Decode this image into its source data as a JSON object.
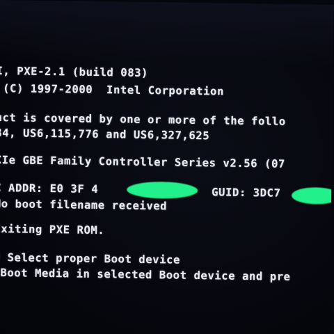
{
  "boot_screen": {
    "lines": [
      "I, PXE-2.1 (build 083)",
      " (C) 1997-2000  Intel Corporation",
      "uct is covered by one or more of the follo",
      "84, US6,115,776 and US6,327,625",
      "CIe GBE Family Controller Series v2.56 (07",
      "C ADDR: E0 3F 4",
      "GUID: 3DC7",
      "No boot filename received",
      "Exiting PXE ROM.",
      "d Select proper Boot device",
      " Boot Media in selected Boot device and pre"
    ],
    "redaction_color": "#22f08a"
  }
}
